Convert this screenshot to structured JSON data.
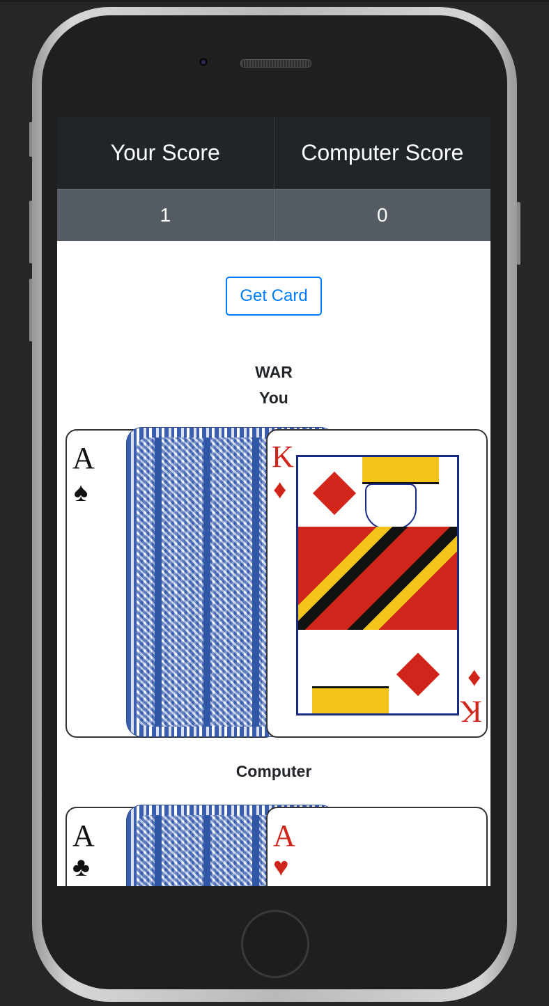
{
  "scoreboard": {
    "headers": [
      "Your Score",
      "Computer Score"
    ],
    "values": [
      "1",
      "0"
    ]
  },
  "actions": {
    "get_card_label": "Get Card"
  },
  "game": {
    "title": "WAR",
    "player_label": "You",
    "computer_label": "Computer"
  },
  "player_hand": {
    "cards": [
      {
        "rank": "A",
        "suit": "♠",
        "suit_color": "#111111"
      },
      {
        "type": "card-back",
        "color": "#3b5fae"
      },
      {
        "rank": "K",
        "suit": "♦",
        "suit_color": "#d0251a"
      }
    ]
  },
  "computer_hand": {
    "cards": [
      {
        "rank": "A",
        "suit": "♣",
        "suit_color": "#111111"
      },
      {
        "type": "card-back",
        "color": "#3b5fae"
      },
      {
        "rank": "A",
        "suit": "♥",
        "suit_color": "#d0251a"
      }
    ]
  },
  "colors": {
    "accent": "#007bff",
    "header_bg": "#212529",
    "row_bg": "#545b62"
  }
}
